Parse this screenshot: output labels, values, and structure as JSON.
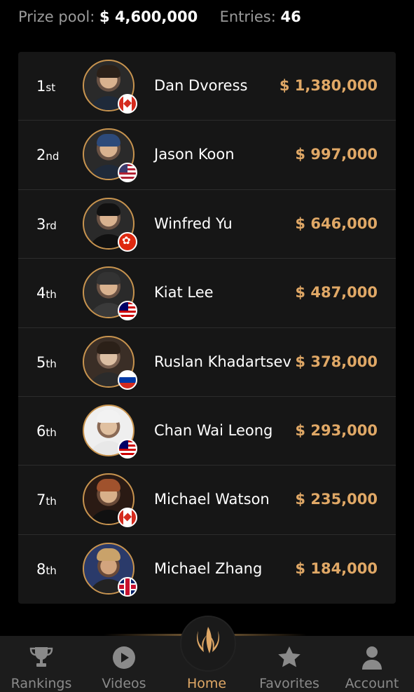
{
  "stats": {
    "prize_pool_label": "Prize pool:",
    "prize_pool_value": "$ 4,600,000",
    "entries_label": "Entries:",
    "entries_value": "46"
  },
  "results": [
    {
      "place_num": "1",
      "place_suffix": "st",
      "name": "Dan Dvoress",
      "prize": "$ 1,380,000",
      "flag": "canada-flag-icon"
    },
    {
      "place_num": "2",
      "place_suffix": "nd",
      "name": "Jason Koon",
      "prize": "$ 997,000",
      "flag": "usa-flag-icon"
    },
    {
      "place_num": "3",
      "place_suffix": "rd",
      "name": "Winfred Yu",
      "prize": "$ 646,000",
      "flag": "hong-kong-flag-icon"
    },
    {
      "place_num": "4",
      "place_suffix": "th",
      "name": "Kiat Lee",
      "prize": "$ 487,000",
      "flag": "malaysia-flag-icon"
    },
    {
      "place_num": "5",
      "place_suffix": "th",
      "name": "Ruslan Khadartsev",
      "prize": "$ 378,000",
      "flag": "russia-flag-icon"
    },
    {
      "place_num": "6",
      "place_suffix": "th",
      "name": "Chan Wai Leong",
      "prize": "$ 293,000",
      "flag": "malaysia-flag-icon"
    },
    {
      "place_num": "7",
      "place_suffix": "th",
      "name": "Michael Watson",
      "prize": "$ 235,000",
      "flag": "canada-flag-icon"
    },
    {
      "place_num": "8",
      "place_suffix": "th",
      "name": "Michael Zhang",
      "prize": "$ 184,000",
      "flag": "uk-flag-icon"
    }
  ],
  "nav": {
    "rankings": "Rankings",
    "videos": "Videos",
    "home": "Home",
    "favorites": "Favorites",
    "account": "Account",
    "active": "home"
  },
  "colors": {
    "accent": "#e0a866",
    "background": "#000000",
    "card": "#161616",
    "muted": "#8a8a8a"
  }
}
